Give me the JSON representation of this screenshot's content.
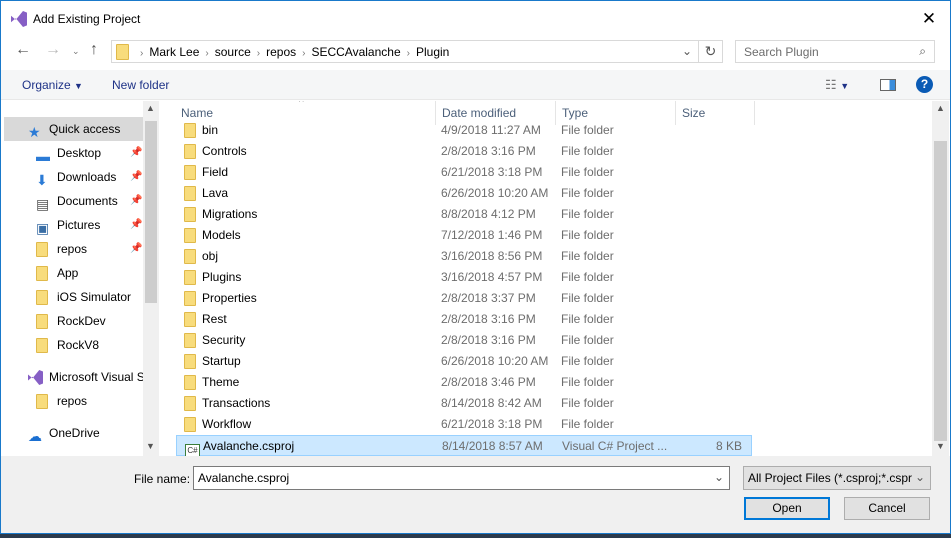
{
  "window": {
    "title": "Add Existing Project",
    "close": "✕"
  },
  "address": {
    "crumbs": [
      "Mark Lee",
      "source",
      "repos",
      "SECCAvalanche",
      "Plugin"
    ],
    "search_placeholder": "Search Plugin"
  },
  "toolbar": {
    "organize": "Organize",
    "new_folder": "New folder"
  },
  "nav": {
    "items": [
      {
        "label": "Quick access",
        "icon": "star-icon",
        "pinned": false,
        "selected": true
      },
      {
        "label": "Desktop",
        "icon": "desktop-icon",
        "pinned": true
      },
      {
        "label": "Downloads",
        "icon": "download-icon",
        "pinned": true
      },
      {
        "label": "Documents",
        "icon": "documents-icon",
        "pinned": true
      },
      {
        "label": "Pictures",
        "icon": "pictures-icon",
        "pinned": true
      },
      {
        "label": "repos",
        "icon": "folder-icon",
        "pinned": true
      },
      {
        "label": "App",
        "icon": "folder-icon",
        "pinned": false
      },
      {
        "label": "iOS Simulator",
        "icon": "folder-icon",
        "pinned": false
      },
      {
        "label": "RockDev",
        "icon": "folder-icon",
        "pinned": false
      },
      {
        "label": "RockV8",
        "icon": "folder-icon",
        "pinned": false
      },
      {
        "label": "Microsoft Visual S",
        "icon": "visual-studio-icon",
        "pinned": false
      },
      {
        "label": "repos",
        "icon": "folder-icon",
        "pinned": false
      },
      {
        "label": "OneDrive",
        "icon": "onedrive-icon",
        "pinned": false
      }
    ]
  },
  "columns": [
    "Name",
    "Date modified",
    "Type",
    "Size"
  ],
  "files": [
    {
      "name": "bin",
      "date": "4/9/2018 11:27 AM",
      "type": "File folder",
      "size": ""
    },
    {
      "name": "Controls",
      "date": "2/8/2018 3:16 PM",
      "type": "File folder",
      "size": ""
    },
    {
      "name": "Field",
      "date": "6/21/2018 3:18 PM",
      "type": "File folder",
      "size": ""
    },
    {
      "name": "Lava",
      "date": "6/26/2018 10:20 AM",
      "type": "File folder",
      "size": ""
    },
    {
      "name": "Migrations",
      "date": "8/8/2018 4:12 PM",
      "type": "File folder",
      "size": ""
    },
    {
      "name": "Models",
      "date": "7/12/2018 1:46 PM",
      "type": "File folder",
      "size": ""
    },
    {
      "name": "obj",
      "date": "3/16/2018 8:56 PM",
      "type": "File folder",
      "size": ""
    },
    {
      "name": "Plugins",
      "date": "3/16/2018 4:57 PM",
      "type": "File folder",
      "size": ""
    },
    {
      "name": "Properties",
      "date": "2/8/2018 3:37 PM",
      "type": "File folder",
      "size": ""
    },
    {
      "name": "Rest",
      "date": "2/8/2018 3:16 PM",
      "type": "File folder",
      "size": ""
    },
    {
      "name": "Security",
      "date": "2/8/2018 3:16 PM",
      "type": "File folder",
      "size": ""
    },
    {
      "name": "Startup",
      "date": "6/26/2018 10:20 AM",
      "type": "File folder",
      "size": ""
    },
    {
      "name": "Theme",
      "date": "2/8/2018 3:46 PM",
      "type": "File folder",
      "size": ""
    },
    {
      "name": "Transactions",
      "date": "8/14/2018 8:42 AM",
      "type": "File folder",
      "size": ""
    },
    {
      "name": "Workflow",
      "date": "6/21/2018 3:18 PM",
      "type": "File folder",
      "size": ""
    },
    {
      "name": "Avalanche.csproj",
      "date": "8/14/2018 8:57 AM",
      "type": "Visual C# Project ...",
      "size": "8 KB",
      "selected": true,
      "icon_text": "C#"
    }
  ],
  "bottom": {
    "file_name_label": "File name:",
    "file_name": "Avalanche.csproj",
    "filter": "All Project Files (*.csproj;*.cspro",
    "open": "Open",
    "cancel": "Cancel"
  },
  "colors": {
    "accent": "#0078d7",
    "selection": "#cce8ff",
    "folder": "#f8dc7c"
  }
}
